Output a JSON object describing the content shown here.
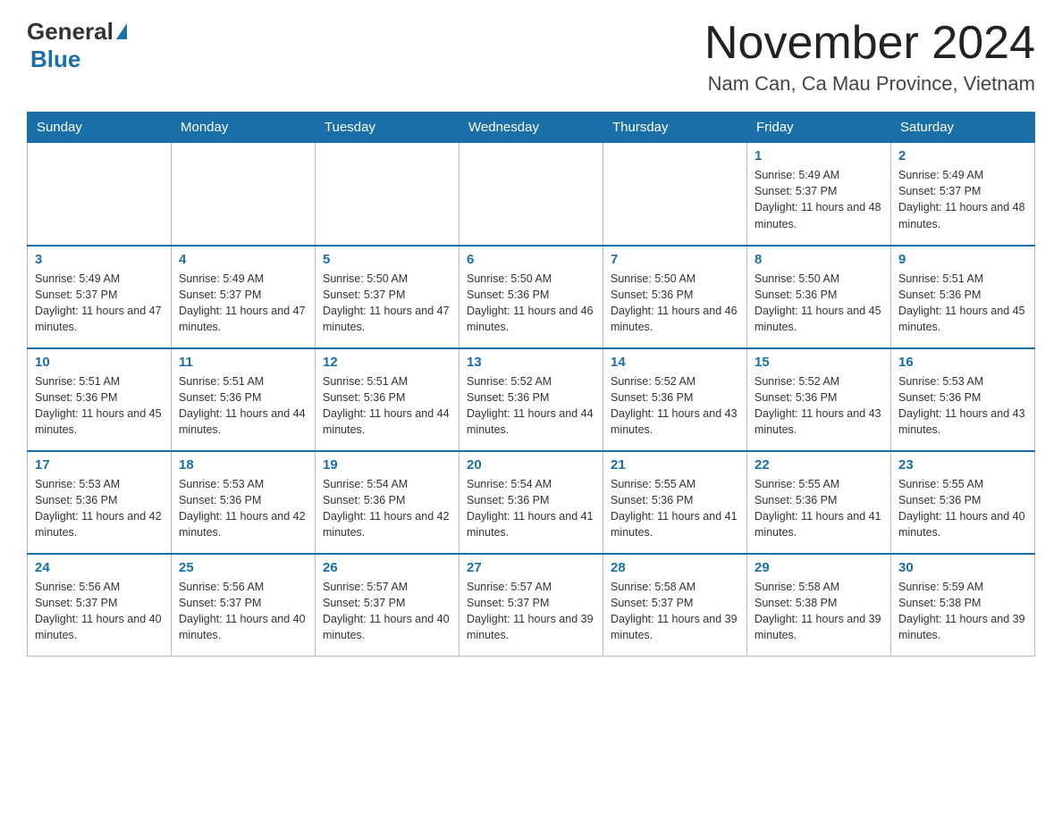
{
  "header": {
    "logo_general": "General",
    "logo_blue": "Blue",
    "title": "November 2024",
    "subtitle": "Nam Can, Ca Mau Province, Vietnam"
  },
  "weekdays": [
    "Sunday",
    "Monday",
    "Tuesday",
    "Wednesday",
    "Thursday",
    "Friday",
    "Saturday"
  ],
  "weeks": [
    [
      {
        "day": "",
        "sunrise": "",
        "sunset": "",
        "daylight": ""
      },
      {
        "day": "",
        "sunrise": "",
        "sunset": "",
        "daylight": ""
      },
      {
        "day": "",
        "sunrise": "",
        "sunset": "",
        "daylight": ""
      },
      {
        "day": "",
        "sunrise": "",
        "sunset": "",
        "daylight": ""
      },
      {
        "day": "",
        "sunrise": "",
        "sunset": "",
        "daylight": ""
      },
      {
        "day": "1",
        "sunrise": "Sunrise: 5:49 AM",
        "sunset": "Sunset: 5:37 PM",
        "daylight": "Daylight: 11 hours and 48 minutes."
      },
      {
        "day": "2",
        "sunrise": "Sunrise: 5:49 AM",
        "sunset": "Sunset: 5:37 PM",
        "daylight": "Daylight: 11 hours and 48 minutes."
      }
    ],
    [
      {
        "day": "3",
        "sunrise": "Sunrise: 5:49 AM",
        "sunset": "Sunset: 5:37 PM",
        "daylight": "Daylight: 11 hours and 47 minutes."
      },
      {
        "day": "4",
        "sunrise": "Sunrise: 5:49 AM",
        "sunset": "Sunset: 5:37 PM",
        "daylight": "Daylight: 11 hours and 47 minutes."
      },
      {
        "day": "5",
        "sunrise": "Sunrise: 5:50 AM",
        "sunset": "Sunset: 5:37 PM",
        "daylight": "Daylight: 11 hours and 47 minutes."
      },
      {
        "day": "6",
        "sunrise": "Sunrise: 5:50 AM",
        "sunset": "Sunset: 5:36 PM",
        "daylight": "Daylight: 11 hours and 46 minutes."
      },
      {
        "day": "7",
        "sunrise": "Sunrise: 5:50 AM",
        "sunset": "Sunset: 5:36 PM",
        "daylight": "Daylight: 11 hours and 46 minutes."
      },
      {
        "day": "8",
        "sunrise": "Sunrise: 5:50 AM",
        "sunset": "Sunset: 5:36 PM",
        "daylight": "Daylight: 11 hours and 45 minutes."
      },
      {
        "day": "9",
        "sunrise": "Sunrise: 5:51 AM",
        "sunset": "Sunset: 5:36 PM",
        "daylight": "Daylight: 11 hours and 45 minutes."
      }
    ],
    [
      {
        "day": "10",
        "sunrise": "Sunrise: 5:51 AM",
        "sunset": "Sunset: 5:36 PM",
        "daylight": "Daylight: 11 hours and 45 minutes."
      },
      {
        "day": "11",
        "sunrise": "Sunrise: 5:51 AM",
        "sunset": "Sunset: 5:36 PM",
        "daylight": "Daylight: 11 hours and 44 minutes."
      },
      {
        "day": "12",
        "sunrise": "Sunrise: 5:51 AM",
        "sunset": "Sunset: 5:36 PM",
        "daylight": "Daylight: 11 hours and 44 minutes."
      },
      {
        "day": "13",
        "sunrise": "Sunrise: 5:52 AM",
        "sunset": "Sunset: 5:36 PM",
        "daylight": "Daylight: 11 hours and 44 minutes."
      },
      {
        "day": "14",
        "sunrise": "Sunrise: 5:52 AM",
        "sunset": "Sunset: 5:36 PM",
        "daylight": "Daylight: 11 hours and 43 minutes."
      },
      {
        "day": "15",
        "sunrise": "Sunrise: 5:52 AM",
        "sunset": "Sunset: 5:36 PM",
        "daylight": "Daylight: 11 hours and 43 minutes."
      },
      {
        "day": "16",
        "sunrise": "Sunrise: 5:53 AM",
        "sunset": "Sunset: 5:36 PM",
        "daylight": "Daylight: 11 hours and 43 minutes."
      }
    ],
    [
      {
        "day": "17",
        "sunrise": "Sunrise: 5:53 AM",
        "sunset": "Sunset: 5:36 PM",
        "daylight": "Daylight: 11 hours and 42 minutes."
      },
      {
        "day": "18",
        "sunrise": "Sunrise: 5:53 AM",
        "sunset": "Sunset: 5:36 PM",
        "daylight": "Daylight: 11 hours and 42 minutes."
      },
      {
        "day": "19",
        "sunrise": "Sunrise: 5:54 AM",
        "sunset": "Sunset: 5:36 PM",
        "daylight": "Daylight: 11 hours and 42 minutes."
      },
      {
        "day": "20",
        "sunrise": "Sunrise: 5:54 AM",
        "sunset": "Sunset: 5:36 PM",
        "daylight": "Daylight: 11 hours and 41 minutes."
      },
      {
        "day": "21",
        "sunrise": "Sunrise: 5:55 AM",
        "sunset": "Sunset: 5:36 PM",
        "daylight": "Daylight: 11 hours and 41 minutes."
      },
      {
        "day": "22",
        "sunrise": "Sunrise: 5:55 AM",
        "sunset": "Sunset: 5:36 PM",
        "daylight": "Daylight: 11 hours and 41 minutes."
      },
      {
        "day": "23",
        "sunrise": "Sunrise: 5:55 AM",
        "sunset": "Sunset: 5:36 PM",
        "daylight": "Daylight: 11 hours and 40 minutes."
      }
    ],
    [
      {
        "day": "24",
        "sunrise": "Sunrise: 5:56 AM",
        "sunset": "Sunset: 5:37 PM",
        "daylight": "Daylight: 11 hours and 40 minutes."
      },
      {
        "day": "25",
        "sunrise": "Sunrise: 5:56 AM",
        "sunset": "Sunset: 5:37 PM",
        "daylight": "Daylight: 11 hours and 40 minutes."
      },
      {
        "day": "26",
        "sunrise": "Sunrise: 5:57 AM",
        "sunset": "Sunset: 5:37 PM",
        "daylight": "Daylight: 11 hours and 40 minutes."
      },
      {
        "day": "27",
        "sunrise": "Sunrise: 5:57 AM",
        "sunset": "Sunset: 5:37 PM",
        "daylight": "Daylight: 11 hours and 39 minutes."
      },
      {
        "day": "28",
        "sunrise": "Sunrise: 5:58 AM",
        "sunset": "Sunset: 5:37 PM",
        "daylight": "Daylight: 11 hours and 39 minutes."
      },
      {
        "day": "29",
        "sunrise": "Sunrise: 5:58 AM",
        "sunset": "Sunset: 5:38 PM",
        "daylight": "Daylight: 11 hours and 39 minutes."
      },
      {
        "day": "30",
        "sunrise": "Sunrise: 5:59 AM",
        "sunset": "Sunset: 5:38 PM",
        "daylight": "Daylight: 11 hours and 39 minutes."
      }
    ]
  ]
}
